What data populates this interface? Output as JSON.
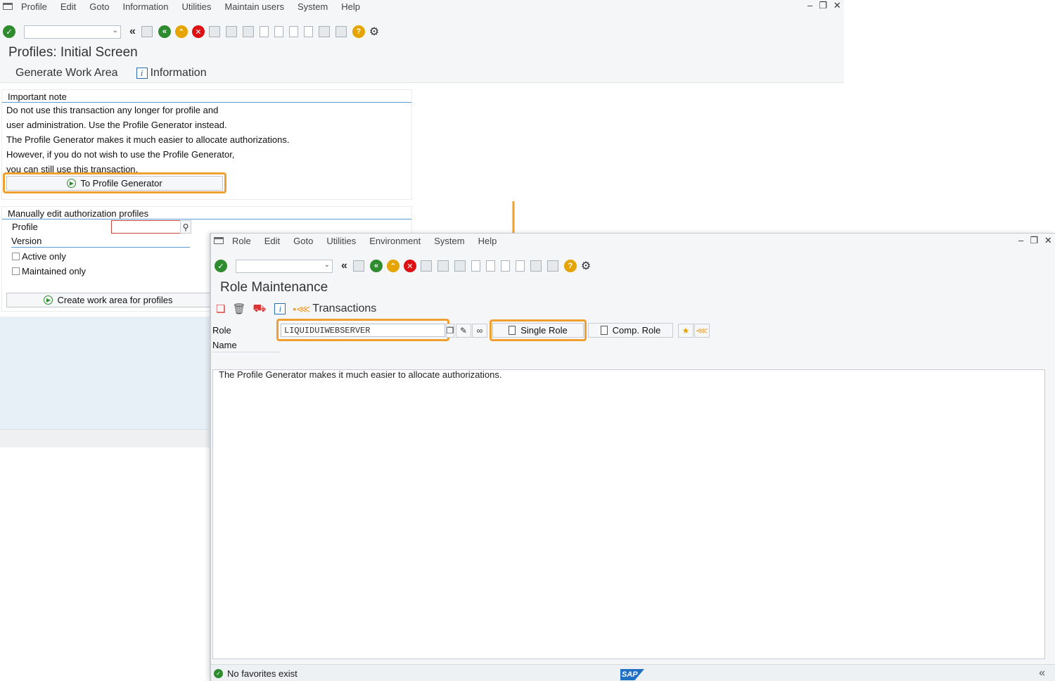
{
  "window1": {
    "menu": [
      "Profile",
      "Edit",
      "Goto",
      "Information",
      "Utilities",
      "Maintain users",
      "System",
      "Help"
    ],
    "title": "Profiles: Initial Screen",
    "appbar": {
      "generate": "Generate Work Area",
      "information": "Information"
    },
    "important_note": {
      "title": "Important note",
      "lines": [
        "Do not use this transaction any longer for profile and",
        "user administration. Use the Profile Generator instead.",
        "The Profile Generator makes it much easier to allocate authorizations.",
        "However, if you do not wish to use the Profile Generator,",
        "you can still use this transaction."
      ],
      "button": "To Profile Generator"
    },
    "manual_edit": {
      "title": "Manually edit authorization profiles",
      "profile_label": "Profile",
      "profile_value": "",
      "version_label": "Version",
      "active_only": "Active only",
      "maintained_only": "Maintained only",
      "create_button": "Create work area for profiles"
    }
  },
  "window2": {
    "menu": [
      "Role",
      "Edit",
      "Goto",
      "Utilities",
      "Environment",
      "System",
      "Help"
    ],
    "title": "Role Maintenance",
    "appbar": {
      "transactions": "Transactions"
    },
    "role_label": "Role",
    "role_value": "LIQUIDUIWEBSERVER",
    "name_label": "Name",
    "single_role": "Single Role",
    "comp_role": "Comp. Role",
    "text_line": "The Profile Generator makes it much easier to allocate authorizations.",
    "status": "No favorites exist",
    "sap_logo": "SAP"
  },
  "colors": {
    "highlight": "#f0a030",
    "accent": "#5b9bd5",
    "ok": "#2e8b2e",
    "cancel": "#dd1111",
    "warn": "#e5a400"
  }
}
